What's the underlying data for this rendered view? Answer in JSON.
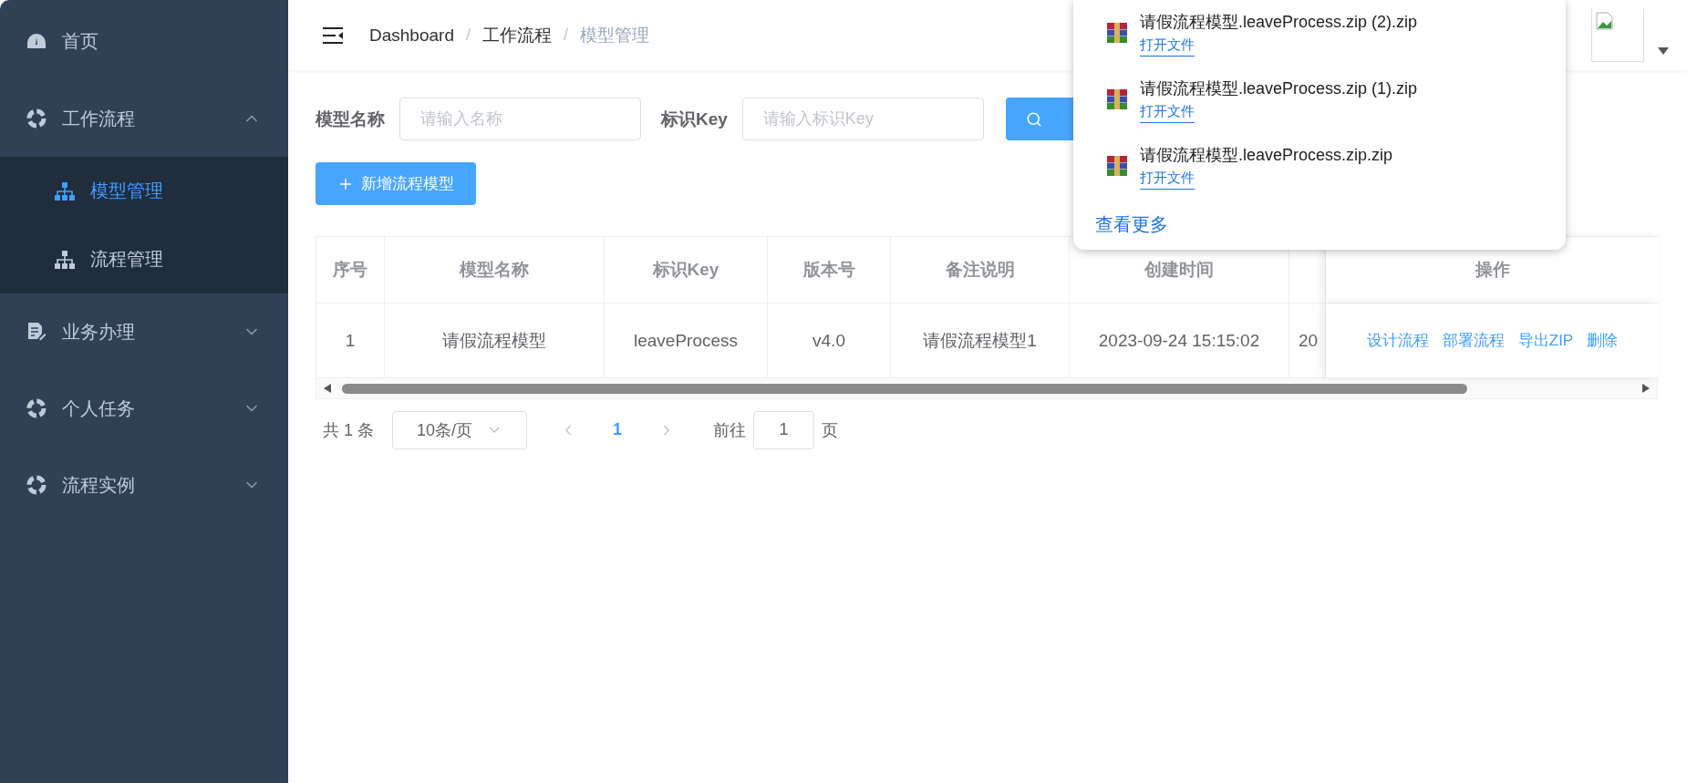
{
  "sidebar": {
    "items": [
      {
        "kind": "link",
        "label": "首页",
        "selected": false
      },
      {
        "kind": "group",
        "label": "工作流程",
        "expanded": true,
        "children": [
          {
            "label": "模型管理",
            "selected": true
          },
          {
            "label": "流程管理",
            "selected": false
          }
        ]
      },
      {
        "kind": "group",
        "label": "业务办理",
        "expanded": false
      },
      {
        "kind": "group",
        "label": "个人任务",
        "expanded": false
      },
      {
        "kind": "group",
        "label": "流程实例",
        "expanded": false
      }
    ]
  },
  "breadcrumb_separator": "/",
  "breadcrumb": [
    {
      "label": "Dashboard",
      "current": false
    },
    {
      "label": "工作流程",
      "current": false
    },
    {
      "label": "模型管理",
      "current": true
    }
  ],
  "search": {
    "fields": [
      {
        "label": "模型名称",
        "placeholder": "请输入名称"
      },
      {
        "label": "标识Key",
        "placeholder": "请输入标识Key"
      }
    ]
  },
  "add_button": "新增流程模型",
  "table": {
    "columns": [
      "序号",
      "模型名称",
      "标识Key",
      "版本号",
      "备注说明",
      "创建时间",
      "",
      "操作"
    ],
    "rows": [
      {
        "cells": [
          "1",
          "请假流程模型",
          "leaveProcess",
          "v4.0",
          "请假流程模型1",
          "2023-09-24 15:15:02",
          "20"
        ],
        "actions": [
          "设计流程",
          "部署流程",
          "导出ZIP",
          "删除"
        ]
      }
    ]
  },
  "pagination": {
    "total": "共 1 条",
    "page_size": "10条/页",
    "pages": [
      {
        "label": "1",
        "selected": true
      }
    ],
    "goto_label": "前往",
    "goto_value": "1",
    "goto_suffix": "页"
  },
  "downloads": {
    "items": [
      {
        "name": "请假流程模型.leaveProcess.zip (2).zip",
        "action": "打开文件"
      },
      {
        "name": "请假流程模型.leaveProcess.zip (1).zip",
        "action": "打开文件"
      },
      {
        "name": "请假流程模型.leaveProcess.zip.zip",
        "action": "打开文件"
      }
    ],
    "more": "查看更多"
  }
}
